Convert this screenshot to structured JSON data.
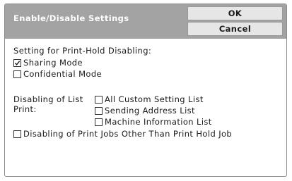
{
  "dialog": {
    "title": "Enable/Disable Settings",
    "ok_label": "OK",
    "cancel_label": "Cancel"
  },
  "print_hold": {
    "heading": "Setting for Print-Hold Disabling:",
    "options": [
      {
        "label": "Sharing Mode",
        "checked": true
      },
      {
        "label": "Confidential Mode",
        "checked": false
      }
    ]
  },
  "list_print": {
    "heading_line1": "Disabling of List",
    "heading_line2": "Print:",
    "options": [
      {
        "label": "All Custom Setting List",
        "checked": false
      },
      {
        "label": "Sending Address List",
        "checked": false
      },
      {
        "label": "Machine Information List",
        "checked": false
      }
    ]
  },
  "print_jobs": {
    "label": "Disabling of Print Jobs Other Than Print Hold Job",
    "checked": false
  }
}
